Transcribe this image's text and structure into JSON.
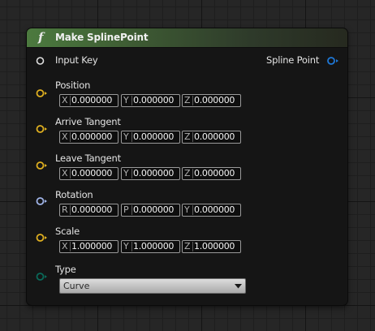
{
  "node": {
    "title": "Make SplinePoint",
    "function_icon": "f",
    "function_icon_name": "function-icon",
    "header_color": "#4c7a3f",
    "background": "#151515"
  },
  "pins": {
    "input_key": {
      "label": "Input Key",
      "color": "#e0e0e0"
    },
    "spline_point": {
      "label": "Spline Point",
      "color": "#1e78d8"
    },
    "position": {
      "label": "Position",
      "color": "#e0b020",
      "axes": [
        "X",
        "Y",
        "Z"
      ],
      "values": [
        "0.000000",
        "0.000000",
        "0.000000"
      ]
    },
    "arrive_tangent": {
      "label": "Arrive Tangent",
      "color": "#e0b020",
      "axes": [
        "X",
        "Y",
        "Z"
      ],
      "values": [
        "0.000000",
        "0.000000",
        "0.000000"
      ]
    },
    "leave_tangent": {
      "label": "Leave Tangent",
      "color": "#e0b020",
      "axes": [
        "X",
        "Y",
        "Z"
      ],
      "values": [
        "0.000000",
        "0.000000",
        "0.000000"
      ]
    },
    "rotation": {
      "label": "Rotation",
      "color": "#a0b4e8",
      "axes": [
        "R",
        "P",
        "Y"
      ],
      "values": [
        "0.000000",
        "0.000000",
        "0.000000"
      ]
    },
    "scale": {
      "label": "Scale",
      "color": "#e0b020",
      "axes": [
        "X",
        "Y",
        "Z"
      ],
      "values": [
        "1.000000",
        "1.000000",
        "1.000000"
      ]
    },
    "type": {
      "label": "Type",
      "color": "#0a6a5a",
      "selected": "Curve"
    }
  }
}
